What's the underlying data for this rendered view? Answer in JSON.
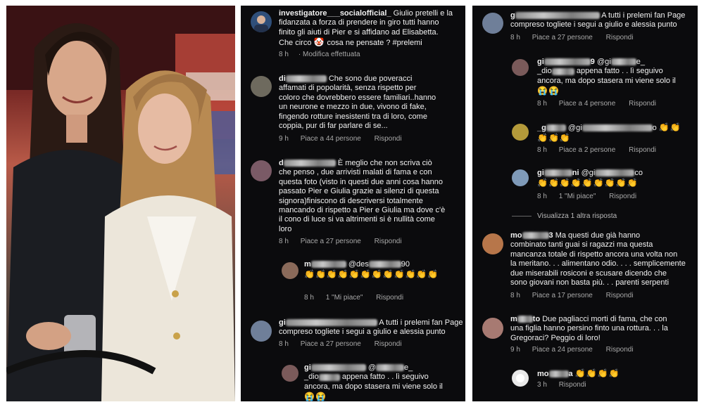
{
  "colors": {
    "panel_bg": "#0b0b0d",
    "text": "#f1f1f1",
    "meta": "#a8a8a8"
  },
  "icons": {
    "clap": "clapping-hands-icon",
    "sad": "crying-face-icon",
    "clown": "clown-face-icon"
  },
  "panel2": {
    "c1": {
      "user": "investigatore___socialofficial_",
      "lines": [
        "Giulio pretelli e la",
        "fidanzata a forza di prendere in giro tutti hanno",
        "finito gli aiuti di Pier e si affidano ad Elisabetta.",
        "Che circo",
        "cosa ne pensate ?  #prelemi"
      ],
      "time": "8 h",
      "edited": "Modifica effettuata"
    },
    "c2": {
      "user": "di",
      "lines": [
        "Che sono due poveracci",
        "affamati di popolarità,  senza rispetto per",
        "coloro che dovrebbero essere familiari..hanno",
        "un neurone e mezzo in due,  vivono di fake,",
        "fingendo rotture inesistenti tra di loro,  come",
        "coppia,  pur di far parlare di se..."
      ],
      "time": "9 h",
      "likes": "Piace a 44 persone",
      "reply": "Rispondi"
    },
    "c3": {
      "user": "d",
      "lines": [
        "È  meglio che non scriva ciò",
        "che penso , due arrivisti malati di fama e con",
        "questa foto (visto in questi due anni cosa hanno",
        "passato Pier e Giulia grazie ai silenzi di questa",
        "signora)finiscono di descriversi totalmente",
        "mancando di rispetto a Pier  e Giulia ma dove c'è",
        "il cono di luce si va altrimenti si è  nullità come",
        "loro"
      ],
      "time": "8 h",
      "likes": "Piace a 27 persone",
      "reply": "Rispondi"
    },
    "c4": {
      "user": "m",
      "mention": "@des",
      "mention_tail": "90",
      "time": "8 h",
      "likes": "1 \"Mi piace\"",
      "reply": "Rispondi"
    },
    "c5": {
      "user": "gi",
      "lines": [
        "A tutti i prelemi fan Page",
        "compreso togliete i segui a giulio e alessia punto"
      ],
      "time": "8 h",
      "likes": "Piace a 27 persone",
      "reply": "Rispondi"
    },
    "c6": {
      "user": "gi",
      "mention": "@",
      "mention_tail": "e_",
      "lines": [
        "_dio",
        "appena fatto . . lì seguivo",
        "ancora,  ma dopo stasera mi viene solo il"
      ]
    }
  },
  "panel3": {
    "c1": {
      "user": "g",
      "lines": [
        "A tutti i prelemi fan Page",
        "compreso togliete i segui a giulio e alessia punto"
      ],
      "time": "8 h",
      "likes": "Piace a 27 persone",
      "reply": "Rispondi"
    },
    "c2": {
      "user": "gi",
      "user_tail": "9",
      "mention": "@gi",
      "mention_tail": "e_",
      "lines": [
        "_dio",
        "appena fatto . . lì seguivo",
        "ancora,  ma dopo stasera mi viene solo il"
      ],
      "time": "8 h",
      "likes": "Piace a 4 persone",
      "reply": "Rispondi"
    },
    "c3": {
      "user": "_g",
      "mention": "@gi",
      "mention_tail": "o",
      "time": "8 h",
      "likes": "Piace a 2 persone",
      "reply": "Rispondi"
    },
    "c4": {
      "user": "gi",
      "user_tail": "ni",
      "mention": "@gi",
      "mention_tail": "co",
      "time": "8 h",
      "likes": "1 \"Mi piace\"",
      "reply": "Rispondi"
    },
    "view_more": "Visualizza 1 altra risposta",
    "c5": {
      "user": "mo",
      "user_tail": "3",
      "lines": [
        "Ma questi due già hanno",
        "combinato tanti guai si ragazzi ma questa",
        "mancanza totale di rispetto ancora una volta non",
        "la meritano. . . alimentano odio. . . .  semplicemente",
        "due miserabili rosiconi e scusare dicendo che",
        "sono giovani non basta più. . .  parenti serpenti"
      ],
      "time": "8 h",
      "likes": "Piace a 17 persone",
      "reply": "Rispondi"
    },
    "c6": {
      "user": "m",
      "user_tail": "to",
      "lines": [
        "Due pagliacci morti di fama,  che con",
        "una figlia hanno persino finto una rottura. . . la",
        "Gregoraci?  Peggio di loro!"
      ],
      "time": "9 h",
      "likes": "Piace a 24 persone",
      "reply": "Rispondi"
    },
    "c7": {
      "user": "mo",
      "user_tail": "a",
      "time": "3 h",
      "reply": "Rispondi"
    }
  }
}
